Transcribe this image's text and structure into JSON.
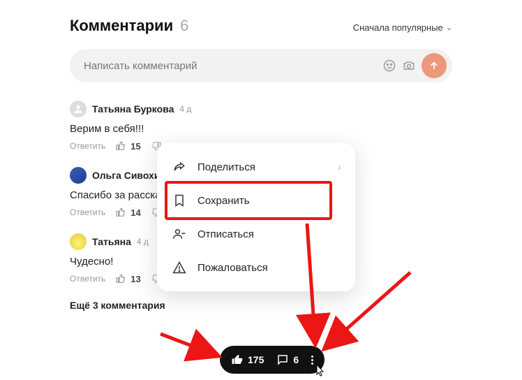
{
  "header": {
    "title": "Комментарии",
    "count": "6"
  },
  "sort": {
    "label": "Сначала популярные"
  },
  "compose": {
    "placeholder": "Написать комментарий"
  },
  "comments": [
    {
      "author": "Татьяна Буркова",
      "ago": "4 д",
      "body": "Верим в себя!!!",
      "reply": "Ответить",
      "likes": "15"
    },
    {
      "author": "Ольга Сивохина",
      "ago": "",
      "body": "Спасибо за рассказ о",
      "reply": "Ответить",
      "likes": "14"
    },
    {
      "author": "Татьяна",
      "ago": "4 д",
      "body": "Чудесно!",
      "reply": "Ответить",
      "likes": "13"
    }
  ],
  "more_comments": "Ещё 3 комментария",
  "popover": {
    "share": "Поделиться",
    "save": "Сохранить",
    "unsubscribe": "Отписаться",
    "report": "Пожаловаться"
  },
  "pill": {
    "likes": "175",
    "comments": "6"
  }
}
